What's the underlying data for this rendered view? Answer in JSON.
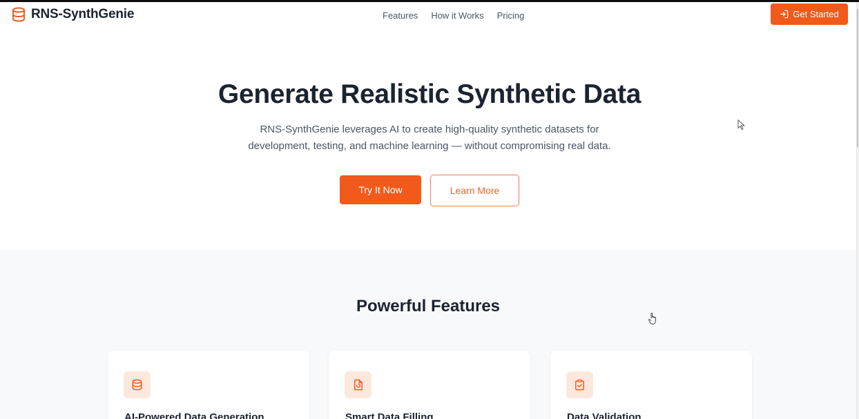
{
  "header": {
    "logo_text": "RNS-SynthGenie",
    "logo_icon": "database-icon",
    "nav": [
      "Features",
      "How it Works",
      "Pricing"
    ],
    "cta_label": "Get Started",
    "cta_icon": "sign-in-icon"
  },
  "hero": {
    "title": "Generate Realistic Synthetic Data",
    "subtitle_line1": "RNS-SynthGenie leverages AI to create high-quality synthetic datasets for",
    "subtitle_line2": "development, testing, and machine learning — without compromising real data.",
    "primary_button": "Try It Now",
    "secondary_button": "Learn More"
  },
  "features": {
    "title": "Powerful Features",
    "cards": [
      {
        "icon": "database-icon",
        "title": "AI-Powered Data Generation"
      },
      {
        "icon": "file-refresh-icon",
        "title": "Smart Data Filling"
      },
      {
        "icon": "clipboard-check-icon",
        "title": "Data Validation"
      }
    ]
  },
  "colors": {
    "accent": "#f15a1b",
    "accent_soft": "#fde8dd",
    "heading": "#1b2330",
    "body_text": "#4b5563",
    "section_bg": "#f8f9fa"
  }
}
